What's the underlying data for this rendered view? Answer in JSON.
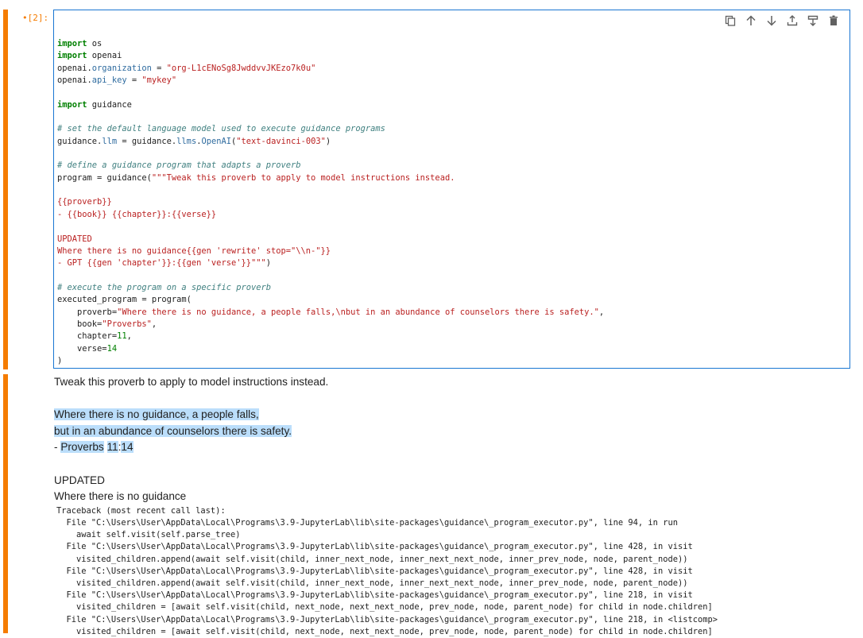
{
  "cell": {
    "prompt": "•[2]:",
    "toolbar": {
      "icons": [
        "copy-icon",
        "move-up-icon",
        "move-down-icon",
        "insert-above-icon",
        "insert-below-icon",
        "delete-icon"
      ]
    },
    "code_lines": [
      "import os",
      "import openai",
      "openai.organization = \"org-L1cENoSg8JwddvvJKEzo7k0u\"",
      "openai.api_key = \"mykey\"",
      "",
      "import guidance",
      "",
      "# set the default language model used to execute guidance programs",
      "guidance.llm = guidance.llms.OpenAI(\"text-davinci-003\")",
      "",
      "# define a guidance program that adapts a proverb",
      "program = guidance(\"\"\"Tweak this proverb to apply to model instructions instead.",
      "",
      "{{proverb}}",
      "- {{book}} {{chapter}}:{{verse}}",
      "",
      "UPDATED",
      "Where there is no guidance{{gen 'rewrite' stop=\"\\\\n-\"}}",
      "- GPT {{gen 'chapter'}}:{{gen 'verse'}}\"\"\")",
      "",
      "# execute the program on a specific proverb",
      "executed_program = program(",
      "    proverb=\"Where there is no guidance, a people falls,\\nbut in an abundance of counselors there is safety.\",",
      "    book=\"Proverbs\",",
      "    chapter=11,",
      "    verse=14",
      ")"
    ]
  },
  "output": {
    "line1": "Tweak this proverb to apply to model instructions instead.",
    "line2": "Where there is no guidance, a people falls,",
    "line3": "but in an abundance of counselors there is safety.",
    "line4_prefix": "- ",
    "line4_book": "Proverbs",
    "line4_chapter": "11",
    "line4_sep": ":",
    "line4_verse": "14",
    "line5": "UPDATED",
    "line6": "Where there is no guidance",
    "traceback": [
      "Traceback (most recent call last):",
      "  File \"C:\\Users\\User\\AppData\\Local\\Programs\\3.9-JupyterLab\\lib\\site-packages\\guidance\\_program_executor.py\", line 94, in run",
      "    await self.visit(self.parse_tree)",
      "  File \"C:\\Users\\User\\AppData\\Local\\Programs\\3.9-JupyterLab\\lib\\site-packages\\guidance\\_program_executor.py\", line 428, in visit",
      "    visited_children.append(await self.visit(child, inner_next_node, inner_next_next_node, inner_prev_node, node, parent_node))",
      "  File \"C:\\Users\\User\\AppData\\Local\\Programs\\3.9-JupyterLab\\lib\\site-packages\\guidance\\_program_executor.py\", line 428, in visit",
      "    visited_children.append(await self.visit(child, inner_next_node, inner_next_next_node, inner_prev_node, node, parent_node))",
      "  File \"C:\\Users\\User\\AppData\\Local\\Programs\\3.9-JupyterLab\\lib\\site-packages\\guidance\\_program_executor.py\", line 218, in visit",
      "    visited_children = [await self.visit(child, next_node, next_next_node, prev_node, node, parent_node) for child in node.children]",
      "  File \"C:\\Users\\User\\AppData\\Local\\Programs\\3.9-JupyterLab\\lib\\site-packages\\guidance\\_program_executor.py\", line 218, in <listcomp>",
      "    visited_children = [await self.visit(child, next_node, next_next_node, prev_node, node, parent_node) for child in node.children]"
    ]
  },
  "colors": {
    "accent": "#f57c00",
    "editor_border": "#1976d2",
    "selection": "#bbdefb"
  }
}
